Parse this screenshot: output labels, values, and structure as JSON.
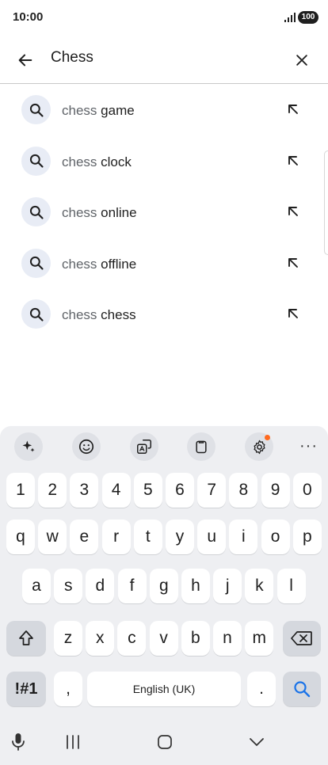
{
  "status_bar": {
    "time": "10:00",
    "battery": "100"
  },
  "search": {
    "query": "Chess"
  },
  "suggestions": [
    {
      "query": "chess",
      "completion": "game"
    },
    {
      "query": "chess",
      "completion": "clock"
    },
    {
      "query": "chess",
      "completion": "online"
    },
    {
      "query": "chess",
      "completion": "offline"
    },
    {
      "query": "chess",
      "completion": "chess"
    }
  ],
  "keyboard": {
    "number_row": [
      "1",
      "2",
      "3",
      "4",
      "5",
      "6",
      "7",
      "8",
      "9",
      "0"
    ],
    "row1": [
      "q",
      "w",
      "e",
      "r",
      "t",
      "y",
      "u",
      "i",
      "o",
      "p"
    ],
    "row2": [
      "a",
      "s",
      "d",
      "f",
      "g",
      "h",
      "j",
      "k",
      "l"
    ],
    "row3": [
      "z",
      "x",
      "c",
      "v",
      "b",
      "n",
      "m"
    ],
    "symbols_label": "!#1",
    "comma": ",",
    "space_label": "English (UK)",
    "period": "."
  },
  "colors": {
    "accent": "#1a73e8",
    "notification_dot": "#ff6a1f"
  },
  "icons": [
    "back-arrow-icon",
    "close-icon",
    "search-icon",
    "north-west-arrow-icon",
    "sparkle-icon",
    "emoji-icon",
    "translate-icon",
    "clipboard-icon",
    "settings-icon",
    "shift-icon",
    "backspace-icon",
    "mic-icon",
    "recents-icon",
    "home-icon",
    "hide-keyboard-icon"
  ]
}
